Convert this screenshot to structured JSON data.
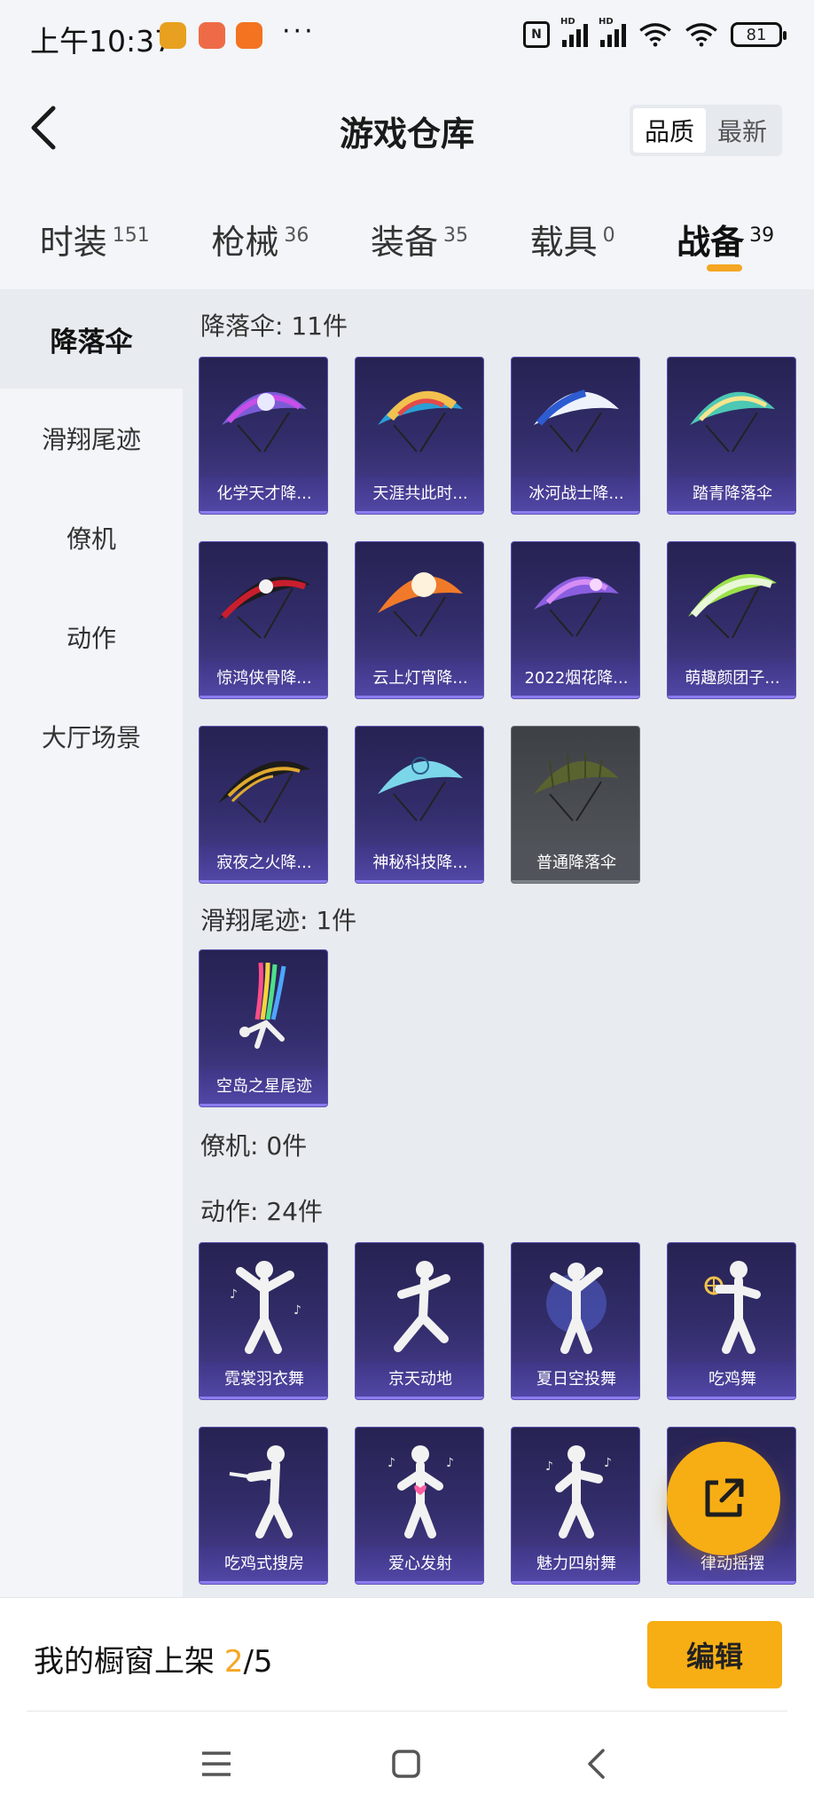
{
  "status_bar": {
    "time": "上午10:37",
    "battery": "81",
    "hd": "HD"
  },
  "header": {
    "title": "游戏仓库",
    "sort_options": [
      "品质",
      "最新"
    ]
  },
  "tabs": [
    {
      "label": "时装",
      "count": "151"
    },
    {
      "label": "枪械",
      "count": "36"
    },
    {
      "label": "装备",
      "count": "35"
    },
    {
      "label": "载具",
      "count": "0"
    },
    {
      "label": "战备",
      "count": "39"
    }
  ],
  "sidebar": [
    "降落伞",
    "滑翔尾迹",
    "僚机",
    "动作",
    "大厅场景"
  ],
  "sections": {
    "parachute": {
      "title": "降落伞: 11件",
      "items": [
        "化学天才降...",
        "天涯共此时...",
        "冰河战士降...",
        "踏青降落伞",
        "惊鸿侠骨降...",
        "云上灯宵降...",
        "2022烟花降...",
        "萌趣颜团子...",
        "寂夜之火降...",
        "神秘科技降...",
        "普通降落伞"
      ]
    },
    "trail": {
      "title": "滑翔尾迹: 1件",
      "items": [
        "空岛之星尾迹"
      ]
    },
    "wingman": {
      "title": "僚机: 0件"
    },
    "emote": {
      "title": "动作: 24件",
      "items": [
        "霓裳羽衣舞",
        "京天动地",
        "夏日空投舞",
        "吃鸡舞",
        "吃鸡式搜房",
        "爱心发射",
        "魅力四射舞",
        "律动摇摆"
      ]
    }
  },
  "bottom": {
    "shelf_prefix": "我的橱窗上架 ",
    "shelf_current": "2",
    "shelf_total": "/5",
    "edit_label": "编辑"
  },
  "colors": {
    "accent": "#f7ae14",
    "card": "#332e6c",
    "card_gray": "#55595e"
  }
}
